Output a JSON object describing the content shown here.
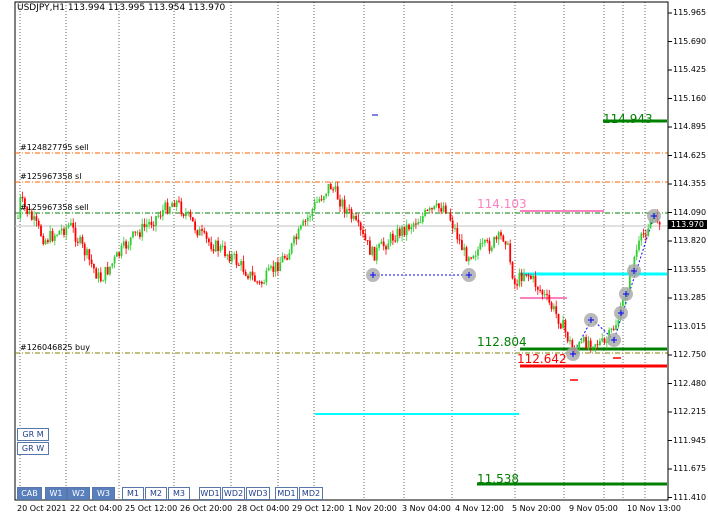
{
  "window": {
    "title": "USDJPY,H1  113.994 113.995 113.954 113.970",
    "current_price_tag": "113.970"
  },
  "order_labels": [
    "#124827795 sell",
    "#125967358 sl",
    "#125967358 sell",
    "#126046825 buy"
  ],
  "level_labels": [
    {
      "text": "114.943",
      "color": "#008000"
    },
    {
      "text": "114.103",
      "color": "#ff80c0"
    },
    {
      "text": "112.804",
      "color": "#008000"
    },
    {
      "text": "112.642",
      "color": "#ff0000"
    },
    {
      "text": "11.538",
      "color": "#008000"
    }
  ],
  "price_axis": {
    "ticks": [
      "115.965",
      "115.690",
      "115.425",
      "115.160",
      "114.895",
      "114.625",
      "114.355",
      "114.090",
      "113.820",
      "113.555",
      "113.285",
      "113.015",
      "112.750",
      "112.480",
      "112.215",
      "111.945",
      "111.675",
      "111.410"
    ]
  },
  "time_axis": {
    "ticks": [
      "20 Oct 2021",
      "22 Oct 04:00",
      "25 Oct 12:00",
      "26 Oct 20:00",
      "28 Oct 04:00",
      "29 Oct 12:00",
      "1 Nov 20:00",
      "3 Nov 04:00",
      "4 Nov 12:00",
      "5 Nov 20:00",
      "9 Nov 05:00",
      "10 Nov 13:00"
    ]
  },
  "timeframe_buttons": [
    {
      "label": "CAB",
      "active": true
    },
    {
      "label": "W1",
      "active": true
    },
    {
      "label": "W2",
      "active": true
    },
    {
      "label": "W3",
      "active": true
    },
    {
      "label": "M1",
      "active": false
    },
    {
      "label": "M2",
      "active": false
    },
    {
      "label": "M3",
      "active": false
    },
    {
      "label": "WD1",
      "active": false
    },
    {
      "label": "WD2",
      "active": false
    },
    {
      "label": "WD3",
      "active": false
    },
    {
      "label": "MD1",
      "active": false
    },
    {
      "label": "MD2",
      "active": false
    }
  ],
  "side_buttons": [
    "GR M",
    "GR W"
  ],
  "colors": {
    "bull": "#32cd32",
    "bear": "#ff0000",
    "grid": "#000000",
    "cyan_level": "#00ffff",
    "green_level": "#008000",
    "red_level": "#ff0000",
    "pink_level": "#ff80c0",
    "orange_dash": "#ff6600"
  }
}
